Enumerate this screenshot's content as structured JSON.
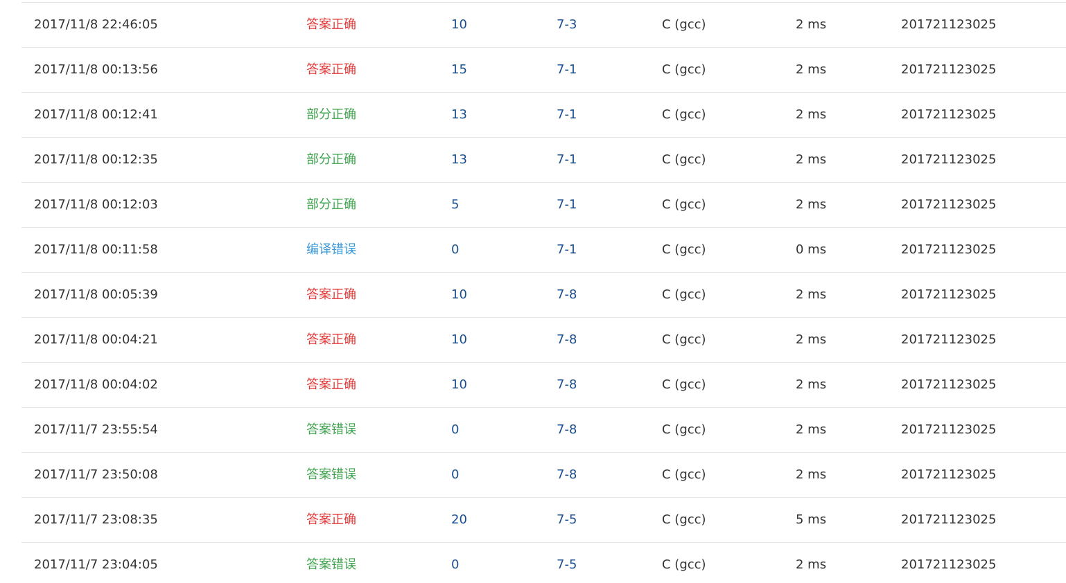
{
  "colors": {
    "accepted": "#e23838",
    "partial": "#3fa34d",
    "wrong": "#3fa34d",
    "compile_error": "#3a9ad9",
    "link": "#1a4f8f",
    "text": "#333333",
    "divider": "#e6e6e6"
  },
  "rows": [
    {
      "time": "2017/11/8 22:46:05",
      "status": "答案正确",
      "status_type": "accepted",
      "score": "10",
      "problem": "7-3",
      "lang": "C (gcc)",
      "mem": "2 ms",
      "user": "201721123025"
    },
    {
      "time": "2017/11/8 00:13:56",
      "status": "答案正确",
      "status_type": "accepted",
      "score": "15",
      "problem": "7-1",
      "lang": "C (gcc)",
      "mem": "2 ms",
      "user": "201721123025"
    },
    {
      "time": "2017/11/8 00:12:41",
      "status": "部分正确",
      "status_type": "partial",
      "score": "13",
      "problem": "7-1",
      "lang": "C (gcc)",
      "mem": "2 ms",
      "user": "201721123025"
    },
    {
      "time": "2017/11/8 00:12:35",
      "status": "部分正确",
      "status_type": "partial",
      "score": "13",
      "problem": "7-1",
      "lang": "C (gcc)",
      "mem": "2 ms",
      "user": "201721123025"
    },
    {
      "time": "2017/11/8 00:12:03",
      "status": "部分正确",
      "status_type": "partial",
      "score": "5",
      "problem": "7-1",
      "lang": "C (gcc)",
      "mem": "2 ms",
      "user": "201721123025"
    },
    {
      "time": "2017/11/8 00:11:58",
      "status": "编译错误",
      "status_type": "compile_error",
      "score": "0",
      "problem": "7-1",
      "lang": "C (gcc)",
      "mem": "0 ms",
      "user": "201721123025"
    },
    {
      "time": "2017/11/8 00:05:39",
      "status": "答案正确",
      "status_type": "accepted",
      "score": "10",
      "problem": "7-8",
      "lang": "C (gcc)",
      "mem": "2 ms",
      "user": "201721123025"
    },
    {
      "time": "2017/11/8 00:04:21",
      "status": "答案正确",
      "status_type": "accepted",
      "score": "10",
      "problem": "7-8",
      "lang": "C (gcc)",
      "mem": "2 ms",
      "user": "201721123025"
    },
    {
      "time": "2017/11/8 00:04:02",
      "status": "答案正确",
      "status_type": "accepted",
      "score": "10",
      "problem": "7-8",
      "lang": "C (gcc)",
      "mem": "2 ms",
      "user": "201721123025"
    },
    {
      "time": "2017/11/7 23:55:54",
      "status": "答案错误",
      "status_type": "wrong",
      "score": "0",
      "problem": "7-8",
      "lang": "C (gcc)",
      "mem": "2 ms",
      "user": "201721123025"
    },
    {
      "time": "2017/11/7 23:50:08",
      "status": "答案错误",
      "status_type": "wrong",
      "score": "0",
      "problem": "7-8",
      "lang": "C (gcc)",
      "mem": "2 ms",
      "user": "201721123025"
    },
    {
      "time": "2017/11/7 23:08:35",
      "status": "答案正确",
      "status_type": "accepted",
      "score": "20",
      "problem": "7-5",
      "lang": "C (gcc)",
      "mem": "5 ms",
      "user": "201721123025"
    },
    {
      "time": "2017/11/7 23:04:05",
      "status": "答案错误",
      "status_type": "wrong",
      "score": "0",
      "problem": "7-5",
      "lang": "C (gcc)",
      "mem": "2 ms",
      "user": "201721123025"
    }
  ]
}
